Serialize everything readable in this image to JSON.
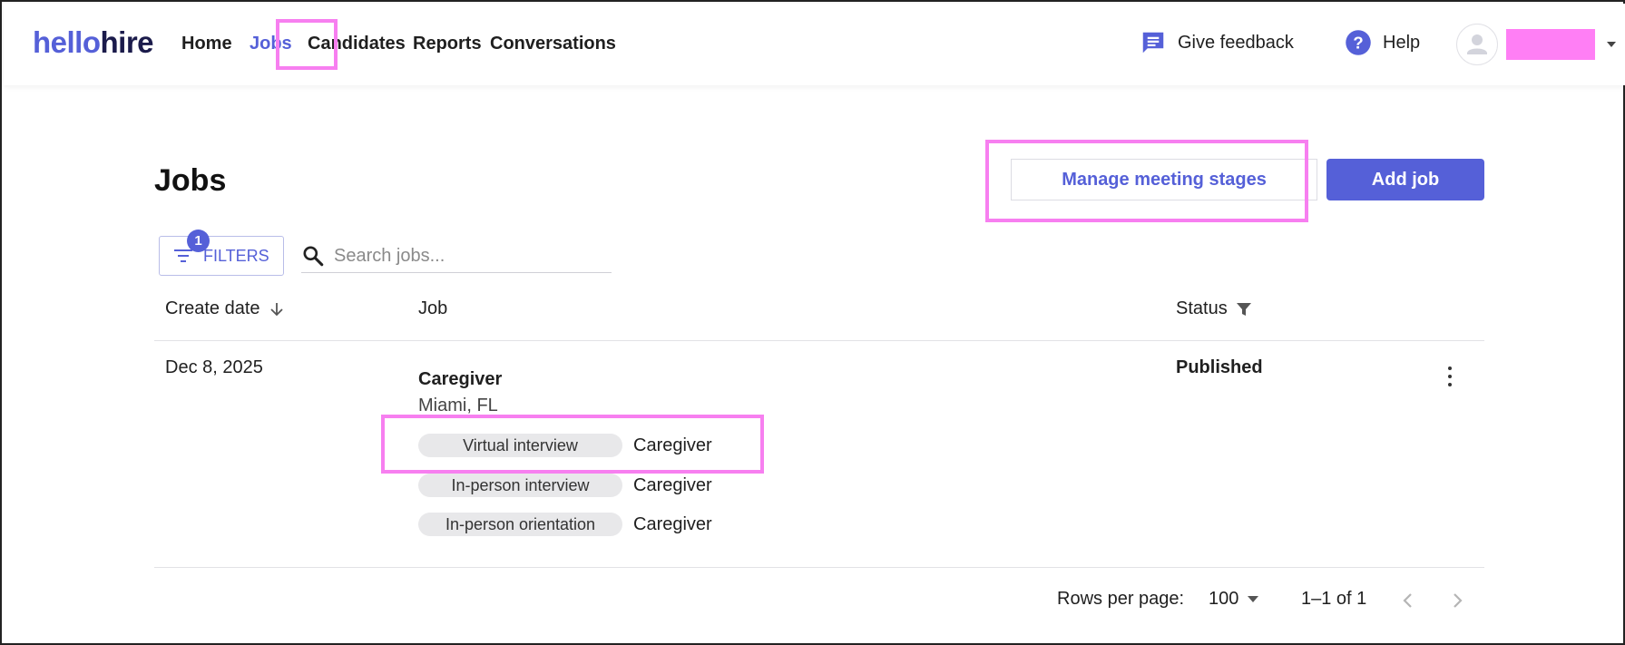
{
  "header": {
    "logo_part1": "hello",
    "logo_part2": "hire",
    "nav": [
      {
        "label": "Home",
        "active": false
      },
      {
        "label": "Jobs",
        "active": true
      },
      {
        "label": "Candidates",
        "active": false
      },
      {
        "label": "Reports",
        "active": false
      },
      {
        "label": "Conversations",
        "active": false
      }
    ],
    "feedback_label": "Give feedback",
    "help_label": "Help"
  },
  "page": {
    "title": "Jobs",
    "manage_stages_label": "Manage meeting stages",
    "add_job_label": "Add job"
  },
  "toolbar": {
    "filters_label": "FILTERS",
    "filters_count": "1",
    "search_placeholder": "Search jobs..."
  },
  "table": {
    "columns": [
      "Create date",
      "Job",
      "Status"
    ],
    "rows": [
      {
        "create_date": "Dec 8, 2025",
        "title": "Caregiver",
        "location": "Miami, FL",
        "stages": [
          {
            "type": "Virtual interview",
            "role": "Caregiver"
          },
          {
            "type": "In-person interview",
            "role": "Caregiver"
          },
          {
            "type": "In-person orientation",
            "role": "Caregiver"
          }
        ],
        "status": "Published"
      }
    ]
  },
  "pagination": {
    "rows_per_page_label": "Rows per page:",
    "rows_per_page_value": "100",
    "range": "1–1 of 1"
  },
  "colors": {
    "accent": "#5560d8",
    "highlight": "#f77ff0",
    "redaction": "#ff7ff5"
  },
  "icons": [
    "feedback-icon",
    "help-icon",
    "avatar-icon",
    "filter-icon",
    "search-icon",
    "sort-down-icon",
    "status-filter-icon",
    "more-vert-icon",
    "chevron-left-icon",
    "chevron-right-icon"
  ]
}
